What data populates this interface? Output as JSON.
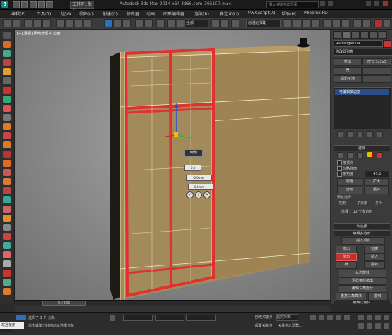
{
  "titlebar": {
    "workspace": "工作区: 默认",
    "title": "Autodesk 3ds Max 2014 x64    3d66.com_395107.max",
    "search_placeholder": "键入关键字或短语"
  },
  "menu": [
    "编辑(E)",
    "工具(T)",
    "组(G)",
    "视图(V)",
    "创建(C)",
    "修改器",
    "动画",
    "图形编辑器",
    "渲染(R)",
    "自定义(U)",
    "MAXScript(X)",
    "帮助(H)",
    "Phoenix FD"
  ],
  "toolbar": {
    "selection_filter": "全部",
    "named_selection": "创建选择集"
  },
  "viewport": {
    "label": "[+][透视][明暗处理 + 边面]"
  },
  "quad_menu": {
    "title": "倒角",
    "height": "0.0",
    "outline": "-0.0mm",
    "amount": "0.0mm"
  },
  "command_panel": {
    "object_name": "Rectangle009",
    "modifier_list": "修改器列表",
    "buttons": [
      {
        "left": "挤出",
        "right": "FFD 3x3x3"
      },
      {
        "left": "壳",
        "right": ""
      },
      {
        "left": "涡轮平滑",
        "right": ""
      }
    ],
    "stack_item": "可编辑多边形",
    "selection_header": "选择",
    "by_vertex": "按顶点",
    "ignore_backfacing": "忽略背面",
    "by_angle": "按角度",
    "angle_value": "45.0",
    "shrink": "收缩",
    "grow": "扩大",
    "ring": "环形",
    "loop": "循环",
    "preview_selection": "预览选择",
    "preview_options": [
      "禁用",
      "子对象",
      "多个"
    ],
    "selected_info": "选择了 12 个多边形",
    "soft_selection_header": "软选择",
    "edit_polygons_header": "编辑多边形",
    "insert_vertex": "插入顶点",
    "extrude": "挤出",
    "outline": "轮廓",
    "bevel": "倒角",
    "inset": "插入",
    "bridge": "桥",
    "flip": "翻转",
    "hinge": "从边旋转",
    "extrude_along_spline": "沿样条线挤出",
    "edit_triangulation": "编辑三角剖分",
    "retriangulate": "重复三角算法",
    "turn": "旋转",
    "edit_geometry_header": "编辑几何体",
    "repeat_last": "重复上一个"
  },
  "timeline": {
    "frame": "0 / 100"
  },
  "status": {
    "welcome": "欢迎使用 MAXSc",
    "selected": "选择了 1 个 对象",
    "prompt": "单击或单击并拖动以选择对象",
    "autokey": "自动关键点",
    "selected_obj": "选定对象",
    "setkey": "设置关键点",
    "key_filter": "关键点过滤器..."
  },
  "colors": {
    "wall": "#a38a5a",
    "selection": "#e03030",
    "wire": "#f0ead0",
    "accent": "#2f6fb3"
  }
}
